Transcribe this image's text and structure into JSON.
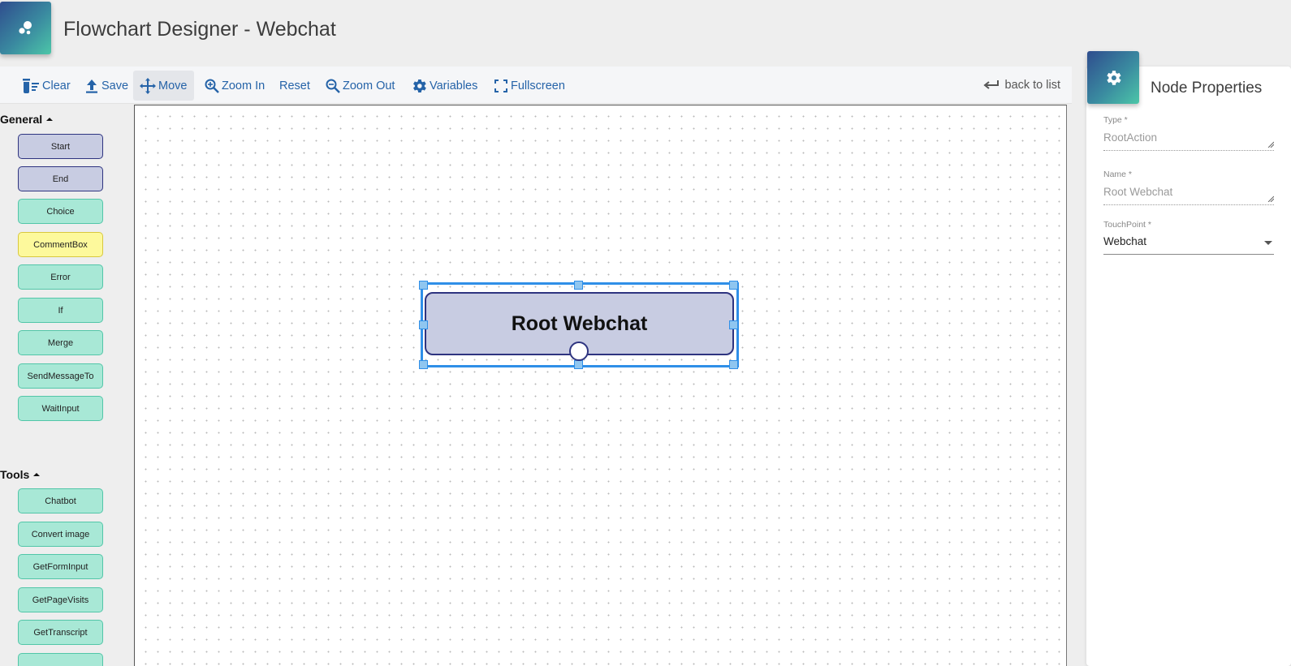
{
  "app": {
    "title": "Flowchart Designer - Webchat"
  },
  "toolbar": {
    "clear": "Clear",
    "save": "Save",
    "move": "Move",
    "zoom_in": "Zoom In",
    "reset": "Reset",
    "zoom_out": "Zoom Out",
    "variables": "Variables",
    "fullscreen": "Fullscreen",
    "back": "back to list"
  },
  "palette": {
    "general": {
      "title": "General",
      "items": [
        "Start",
        "End",
        "Choice",
        "CommentBox",
        "Error",
        "If",
        "Merge",
        "SendMessageTo",
        "WaitInput"
      ]
    },
    "tools": {
      "title": "Tools",
      "items": [
        "Chatbot",
        "Convert image",
        "GetFormInput",
        "GetPageVisits",
        "GetTranscript"
      ]
    }
  },
  "canvas": {
    "node_label": "Root Webchat"
  },
  "properties": {
    "title": "Node Properties",
    "type_label": "Type *",
    "type_value": "RootAction",
    "name_label": "Name *",
    "name_value": "Root Webchat",
    "touchpoint_label": "TouchPoint *",
    "touchpoint_value": "Webchat"
  },
  "colors": {
    "accent": "#2563a8",
    "selection": "#2f8fe8",
    "node_fill": "#c8cce2",
    "node_border": "#2e3480",
    "mint": "#a8e8d6",
    "yellow": "#fdf99c"
  }
}
